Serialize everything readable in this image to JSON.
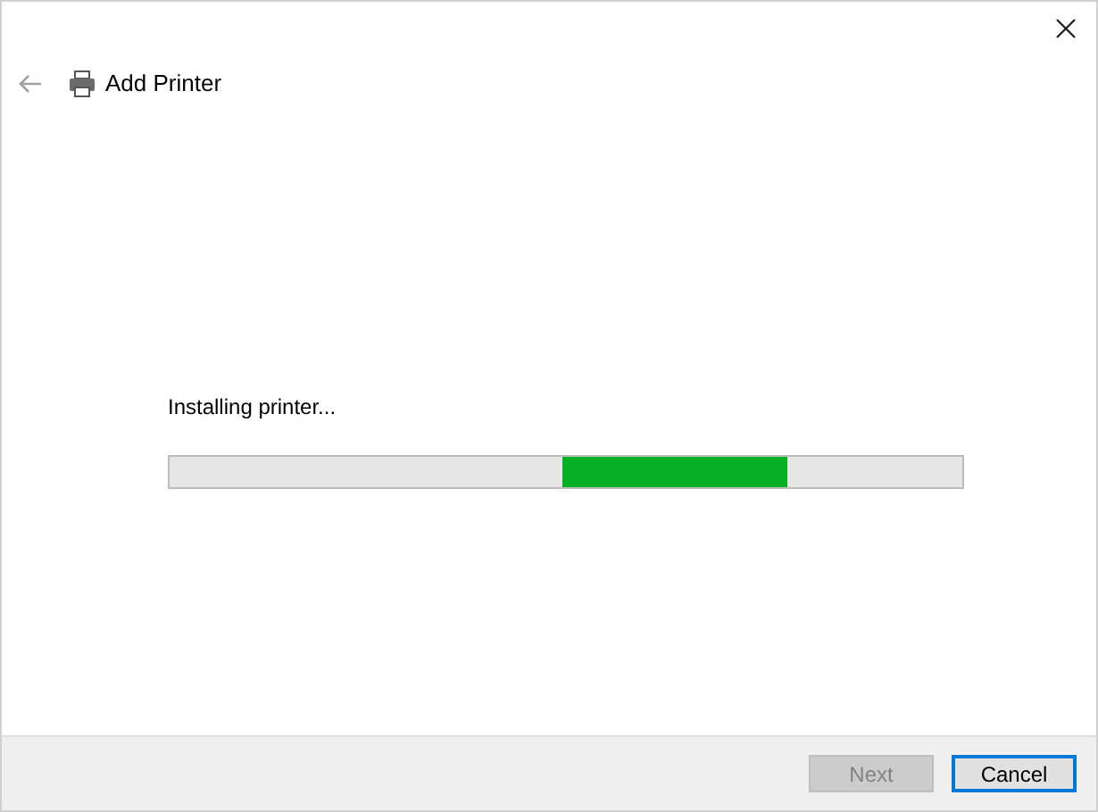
{
  "window": {
    "title": "Add Printer"
  },
  "status": "Installing printer...",
  "progress": {
    "kind": "marquee"
  },
  "buttons": [
    {
      "label": "Next",
      "disabled": true,
      "default": false
    },
    {
      "label": "Cancel",
      "disabled": false,
      "default": true
    }
  ]
}
